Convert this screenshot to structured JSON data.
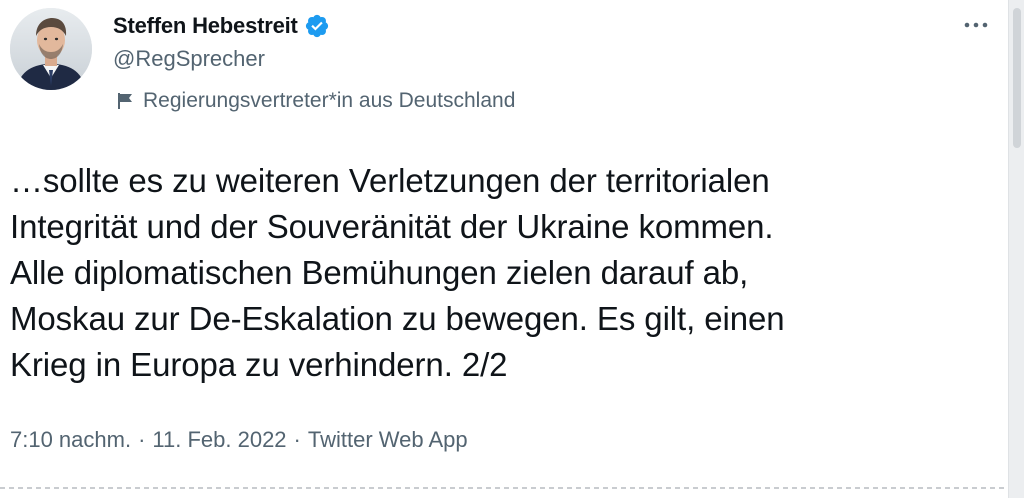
{
  "author": {
    "display_name": "Steffen Hebestreit",
    "handle": "@RegSprecher",
    "verified_icon": "verified-badge-icon",
    "label": "Regierungsvertreter*in aus Deutschland",
    "label_icon": "flag-icon"
  },
  "tweet": {
    "text": "…sollte es zu weiteren Verletzungen der territorialen\nIntegrität und der Souveränität der Ukraine kommen.\nAlle diplomatischen Bemühungen zielen darauf ab,\nMoskau zur De-Eskalation zu bewegen. Es gilt, einen\nKrieg in Europa zu verhindern. 2/2"
  },
  "meta": {
    "time": "7:10 nachm.",
    "separator": "·",
    "date": "11. Feb. 2022",
    "source": "Twitter Web App"
  },
  "more_icon": "more-dots-icon",
  "colors": {
    "accent": "#1d9bf0",
    "secondary_text": "#536471",
    "primary_text": "#0f1419"
  }
}
